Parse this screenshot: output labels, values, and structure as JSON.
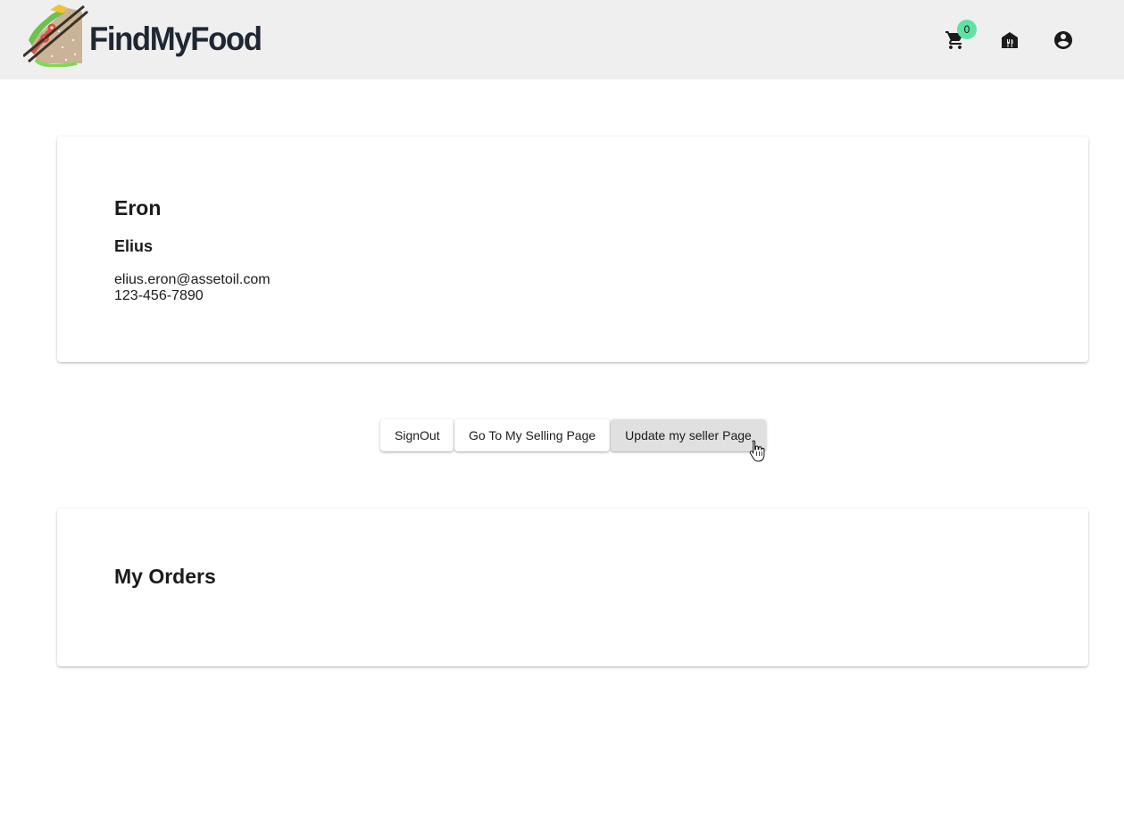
{
  "header": {
    "brand": "FindMyFood",
    "cart_count": "0",
    "icons": {
      "cart": "shopping-cart-icon",
      "store": "store-icon",
      "account": "account-circle-icon"
    }
  },
  "profile": {
    "last_name": "Eron",
    "first_name": "Elius",
    "email": "elius.eron@assetoil.com",
    "phone": "123-456-7890"
  },
  "actions": {
    "signout_label": "SignOut",
    "selling_label": "Go To My Selling Page",
    "update_label": "Update my seller Page"
  },
  "orders": {
    "title": "My Orders"
  },
  "colors": {
    "header_bg": "#efefef",
    "badge": "#5ee3a3",
    "hovered_button": "#e0e0e0"
  }
}
